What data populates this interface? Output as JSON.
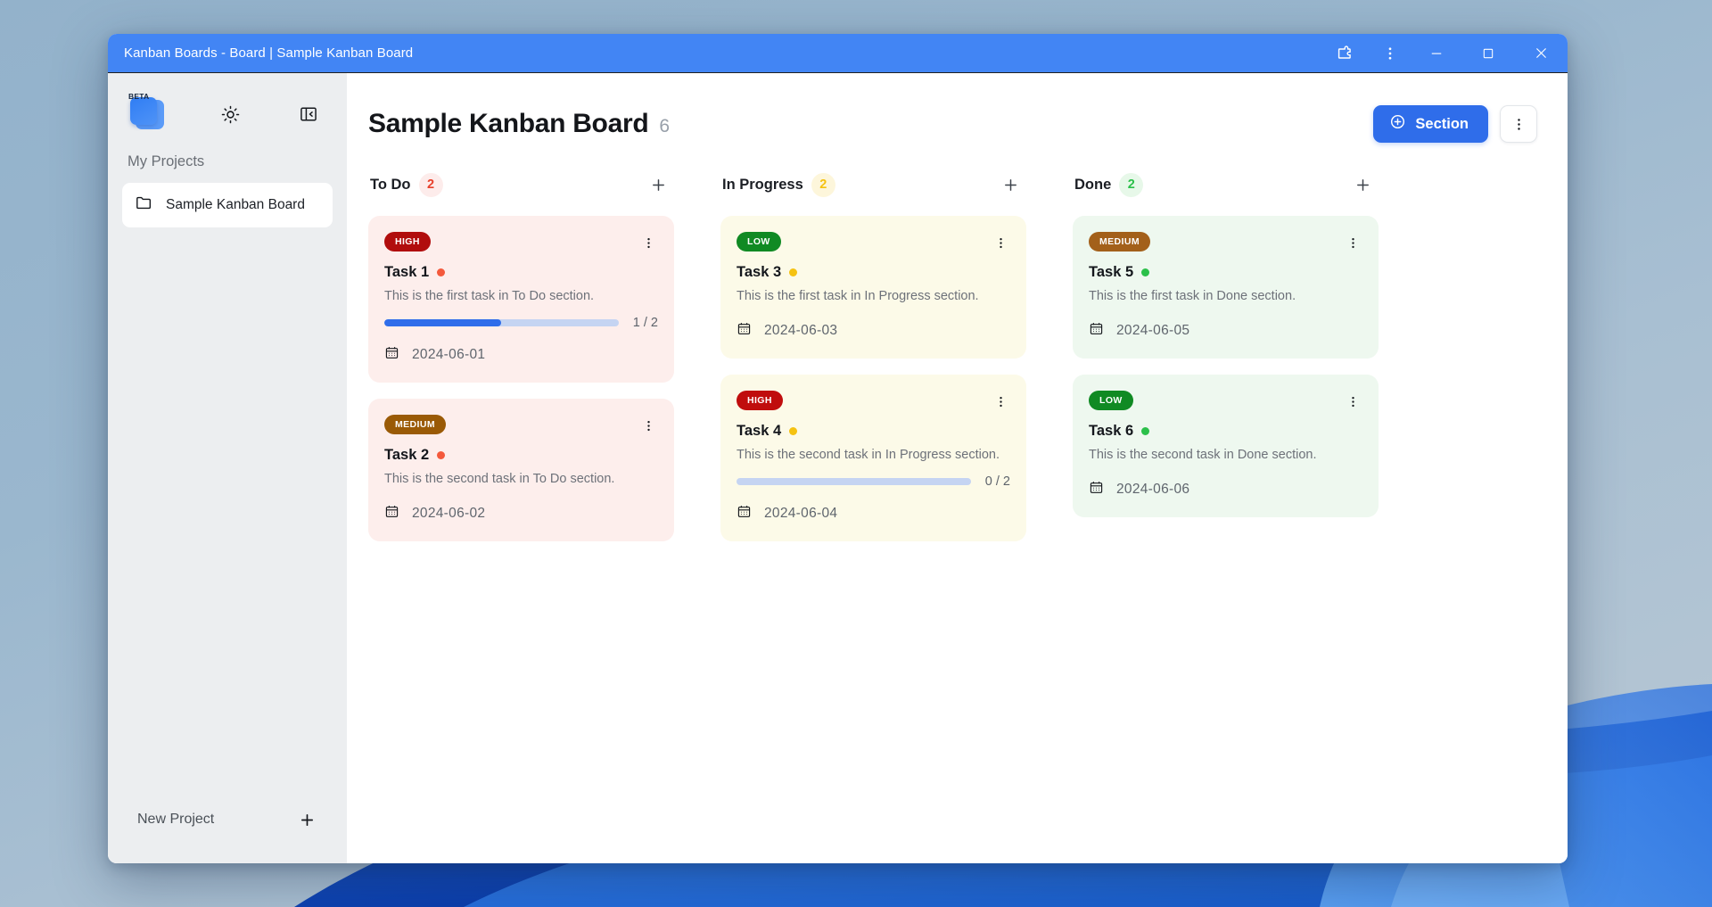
{
  "window": {
    "title": "Kanban Boards - Board | Sample Kanban Board",
    "controls": {
      "extensions": "extensions-icon",
      "menu": "more-vertical-icon",
      "minimize": "minimize-icon",
      "maximize": "maximize-icon",
      "close": "close-icon"
    },
    "titlebar_color": "#4285f4"
  },
  "sidebar": {
    "logo_badge": "BETA",
    "theme_toggle": "sun-icon",
    "collapse_panel": "panel-collapse-icon",
    "section_label": "My Projects",
    "projects": [
      {
        "name": "Sample Kanban Board",
        "icon": "folder-icon"
      }
    ],
    "footer": {
      "label": "New Project",
      "add_icon": "plus-icon"
    }
  },
  "header": {
    "title": "Sample Kanban Board",
    "count": "6",
    "section_button": "Section",
    "section_button_icon": "plus-circle-icon",
    "section_button_color": "#2f6dea",
    "menu_icon": "more-vertical-icon"
  },
  "columns": [
    {
      "title": "To Do",
      "count": "2",
      "badge_color": "#e8412c",
      "badge_bg": "#fdeceb",
      "add_icon": "plus-icon",
      "card_bg": "#fdeeec",
      "cards": [
        {
          "priority": "HIGH",
          "priority_color": "#b10d0d",
          "title": "Task 1",
          "dot_color": "#f4593c",
          "description": "This is the first task in To Do section.",
          "progress": {
            "done": 1,
            "total": 2,
            "text": "1 / 2",
            "percent": 50
          },
          "date": "2024-06-01",
          "menu_icon": "more-vertical-icon",
          "date_icon": "calendar-icon"
        },
        {
          "priority": "MEDIUM",
          "priority_color": "#9a5a06",
          "title": "Task 2",
          "dot_color": "#f4593c",
          "description": "This is the second task in To Do section.",
          "progress": null,
          "date": "2024-06-02",
          "menu_icon": "more-vertical-icon",
          "date_icon": "calendar-icon"
        }
      ]
    },
    {
      "title": "In Progress",
      "count": "2",
      "badge_color": "#f5c211",
      "badge_bg": "#fdf6db",
      "add_icon": "plus-icon",
      "card_bg": "#fcfae8",
      "cards": [
        {
          "priority": "LOW",
          "priority_color": "#108a23",
          "title": "Task 3",
          "dot_color": "#f5c211",
          "description": "This is the first task in In Progress section.",
          "progress": null,
          "date": "2024-06-03",
          "menu_icon": "more-vertical-icon",
          "date_icon": "calendar-icon"
        },
        {
          "priority": "HIGH",
          "priority_color": "#c00d0d",
          "title": "Task 4",
          "dot_color": "#f5c211",
          "description": "This is the second task in In Progress section.",
          "progress": {
            "done": 0,
            "total": 2,
            "text": "0 / 2",
            "percent": 0
          },
          "date": "2024-06-04",
          "menu_icon": "more-vertical-icon",
          "date_icon": "calendar-icon"
        }
      ]
    },
    {
      "title": "Done",
      "count": "2",
      "badge_color": "#2bc04a",
      "badge_bg": "#e7f8e9",
      "add_icon": "plus-icon",
      "card_bg": "#eef8ef",
      "cards": [
        {
          "priority": "MEDIUM",
          "priority_color": "#a3601a",
          "title": "Task 5",
          "dot_color": "#2bc04a",
          "description": "This is the first task in Done section.",
          "progress": null,
          "date": "2024-06-05",
          "menu_icon": "more-vertical-icon",
          "date_icon": "calendar-icon"
        },
        {
          "priority": "LOW",
          "priority_color": "#108a23",
          "title": "Task 6",
          "dot_color": "#2bc04a",
          "description": "This is the second task in Done section.",
          "progress": null,
          "date": "2024-06-06",
          "menu_icon": "more-vertical-icon",
          "date_icon": "calendar-icon"
        }
      ]
    }
  ]
}
